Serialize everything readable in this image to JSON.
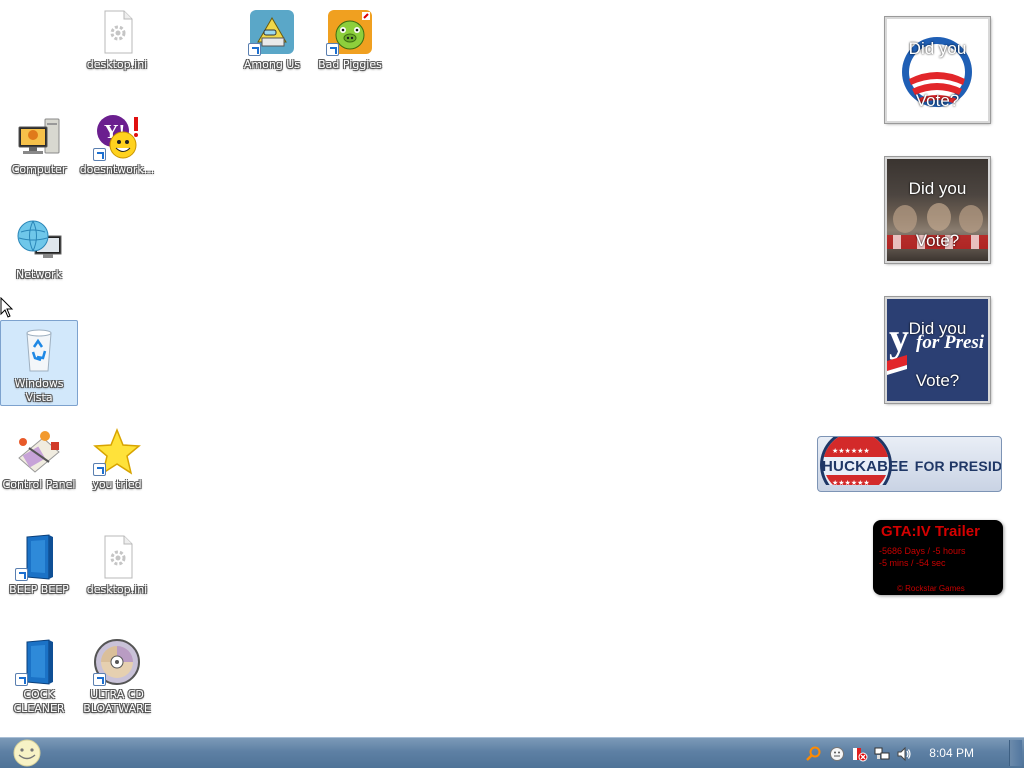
{
  "desktop": {
    "icons": [
      {
        "label": "desktop.ini",
        "type": "file-icon"
      },
      {
        "label": "Among Us",
        "type": "among-us-icon"
      },
      {
        "label": "Bad Piggies",
        "type": "bad-piggies-icon"
      },
      {
        "label": "Computer",
        "type": "computer-icon"
      },
      {
        "label": "doesntwork...",
        "type": "yahoo-messenger-icon"
      },
      {
        "label": "Network",
        "type": "network-icon"
      },
      {
        "label": "Windows Vista",
        "type": "recycle-bin-icon"
      },
      {
        "label": "Control Panel",
        "type": "control-panel-icon"
      },
      {
        "label": "you tried",
        "type": "star-icon"
      },
      {
        "label": "BEEP BEEP",
        "type": "blue-box-icon"
      },
      {
        "label": "desktop.ini",
        "type": "file-icon"
      },
      {
        "label": "COCK CLEANER",
        "type": "blue-box-icon"
      },
      {
        "label": "ULTRA CD BLOATWARE",
        "type": "cd-disc-icon"
      }
    ]
  },
  "gadgets": {
    "vote1": {
      "line1": "Did you",
      "line2": "Vote?"
    },
    "vote2": {
      "line1": "Did you",
      "line2": "Vote?"
    },
    "vote3": {
      "line1": "Did you",
      "line2": "Vote?",
      "overlay": "for Presi"
    },
    "huckabee": {
      "name": "HUCKABEE",
      "suffix": "FOR PRESIDENT"
    },
    "gta": {
      "title": "GTA:IV  Trailer",
      "line1": "-5686 Days / -5 hours",
      "line2": "-5 mins / -54 sec",
      "credit": "© Rockstar Games"
    }
  },
  "taskbar": {
    "start_icon": "start-orb-icon",
    "tray_icons": [
      "search-icon",
      "messenger-icon",
      "security-alert-icon",
      "network-tray-icon",
      "volume-icon"
    ],
    "clock": "8:04 PM"
  },
  "colors": {
    "taskbar": "#5e80a4",
    "selection": "#add6f7",
    "gta_red": "#d40000",
    "huckabee_blue": "#1f3766"
  }
}
